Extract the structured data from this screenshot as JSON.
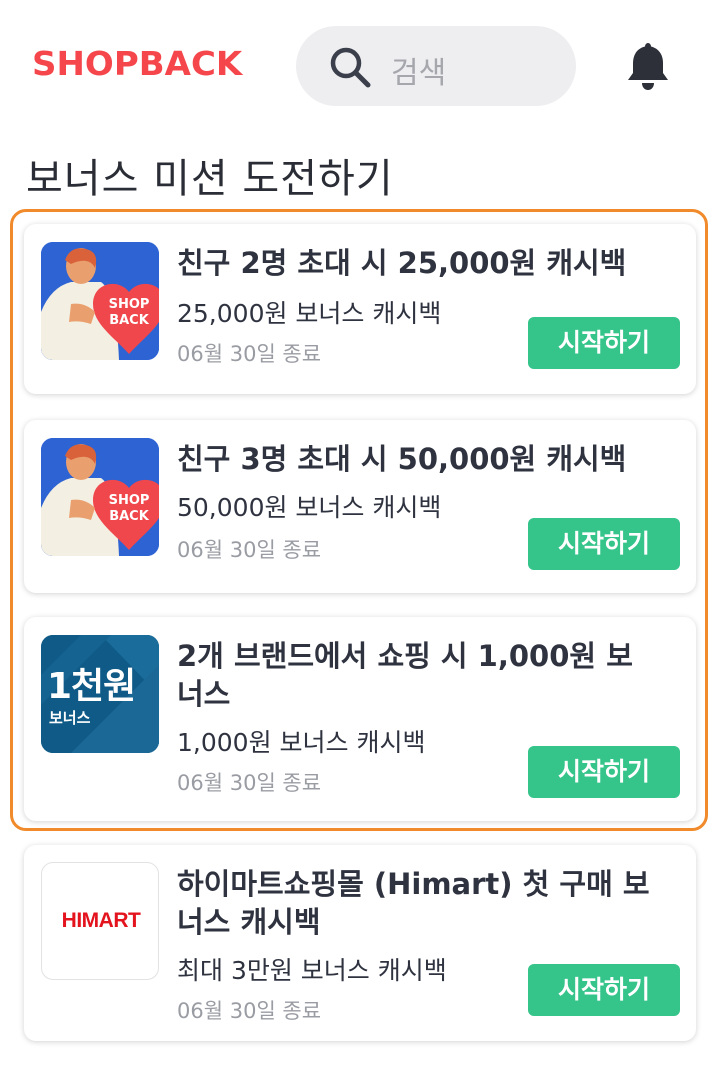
{
  "header": {
    "logo": "SHOPBACK",
    "search_placeholder": "검색",
    "search_icon": "search-icon",
    "bell_icon": "bell-icon"
  },
  "section": {
    "title": "보너스 미션 도전하기"
  },
  "missions": [
    {
      "title": "친구 2명 초대 시 25,000원 캐시백",
      "subtitle": "25,000원 보너스 캐시백",
      "date": "06월 30일 종료",
      "button": "시작하기",
      "thumb_text": "SHOP BACK"
    },
    {
      "title": "친구 3명 초대 시 50,000원 캐시백",
      "subtitle": "50,000원 보너스 캐시백",
      "date": "06월 30일 종료",
      "button": "시작하기",
      "thumb_text": "SHOP BACK"
    },
    {
      "title": "2개 브랜드에서 쇼핑 시 1,000원 보너스",
      "subtitle": "1,000원 보너스 캐시백",
      "date": "06월 30일 종료",
      "button": "시작하기",
      "thumb_big": "1천원",
      "thumb_small": "보너스"
    },
    {
      "title": "하이마트쇼핑몰 (Himart) 첫 구매 보너스 캐시백",
      "subtitle": "최대 3만원 보너스 캐시백",
      "date": "06월 30일 종료",
      "button": "시작하기",
      "thumb_text": "HIMART"
    }
  ],
  "colors": {
    "brand": "#f5464b",
    "button": "#35c48a",
    "highlight_border": "#f08a2a"
  }
}
